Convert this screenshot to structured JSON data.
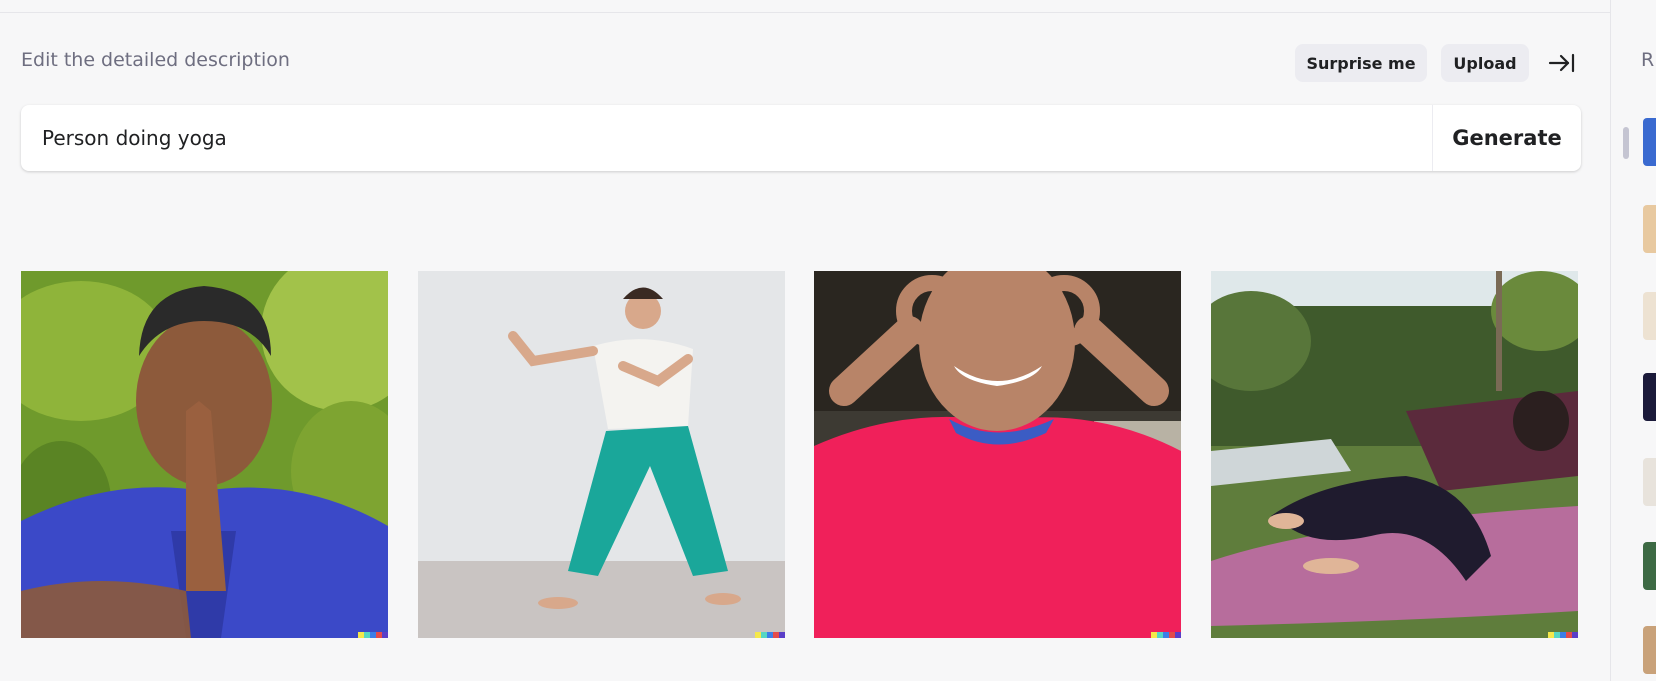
{
  "header": {
    "label": "Edit the detailed description",
    "surprise_label": "Surprise me",
    "upload_label": "Upload",
    "collapse_icon": "arrow-right-to-bar-icon"
  },
  "prompt": {
    "value": "Person doing yoga",
    "generate_label": "Generate"
  },
  "results": [
    {
      "alt": "Man with hands pressed together meditating in blue shirt"
    },
    {
      "alt": "Man in white t-shirt and teal pants in standing pose"
    },
    {
      "alt": "Smiling man in pink shirt making circles with fingers"
    },
    {
      "alt": "Person on purple mat doing yoga in garden"
    }
  ],
  "recent_panel": {
    "label_initial": "R"
  },
  "colors": {
    "background": "#f7f7f8",
    "button_bg": "#ececf1",
    "muted_text": "#6e6e80"
  }
}
